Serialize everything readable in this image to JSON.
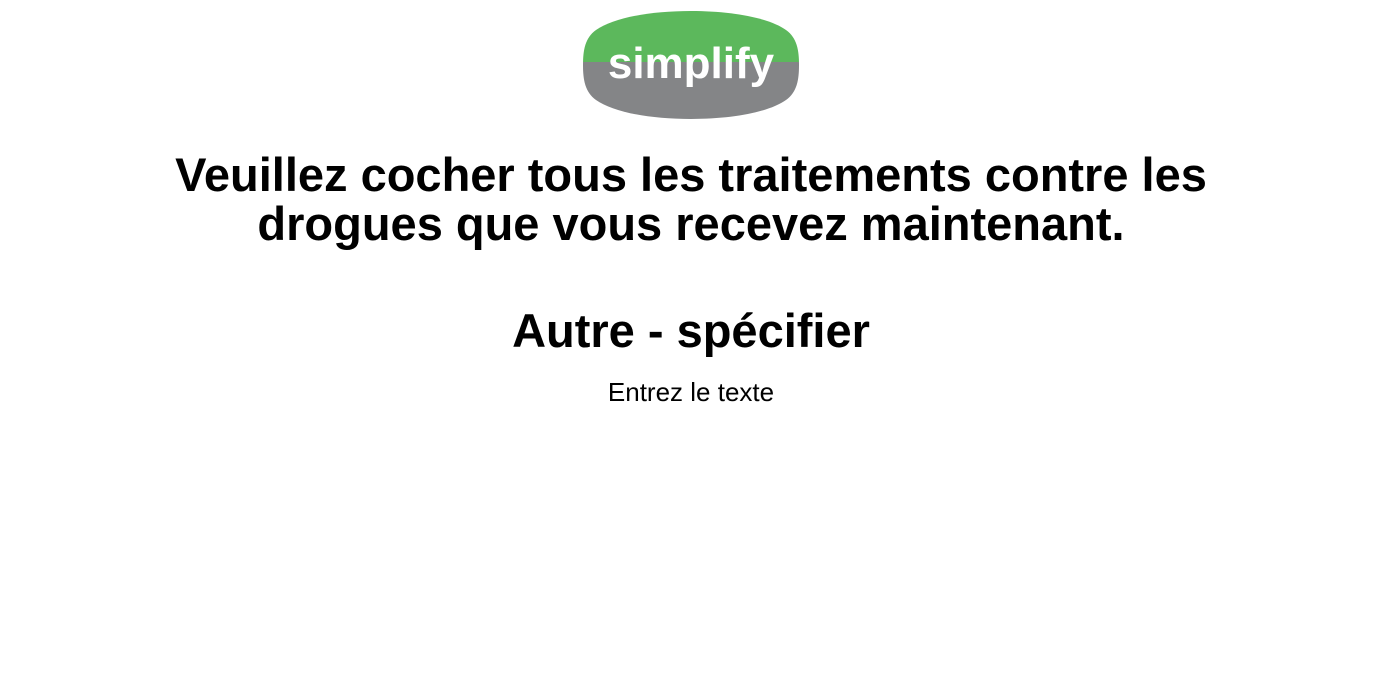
{
  "logo": {
    "text": "simplify",
    "top_color": "#5cb85c",
    "bottom_color": "#848587",
    "text_color": "#ffffff"
  },
  "question": {
    "line1": "Veuillez cocher tous les traitements contre les",
    "line2": "drogues que vous recevez maintenant."
  },
  "option": {
    "title": "Autre - spécifier"
  },
  "input": {
    "value": "",
    "placeholder": "Entrez le texte"
  }
}
